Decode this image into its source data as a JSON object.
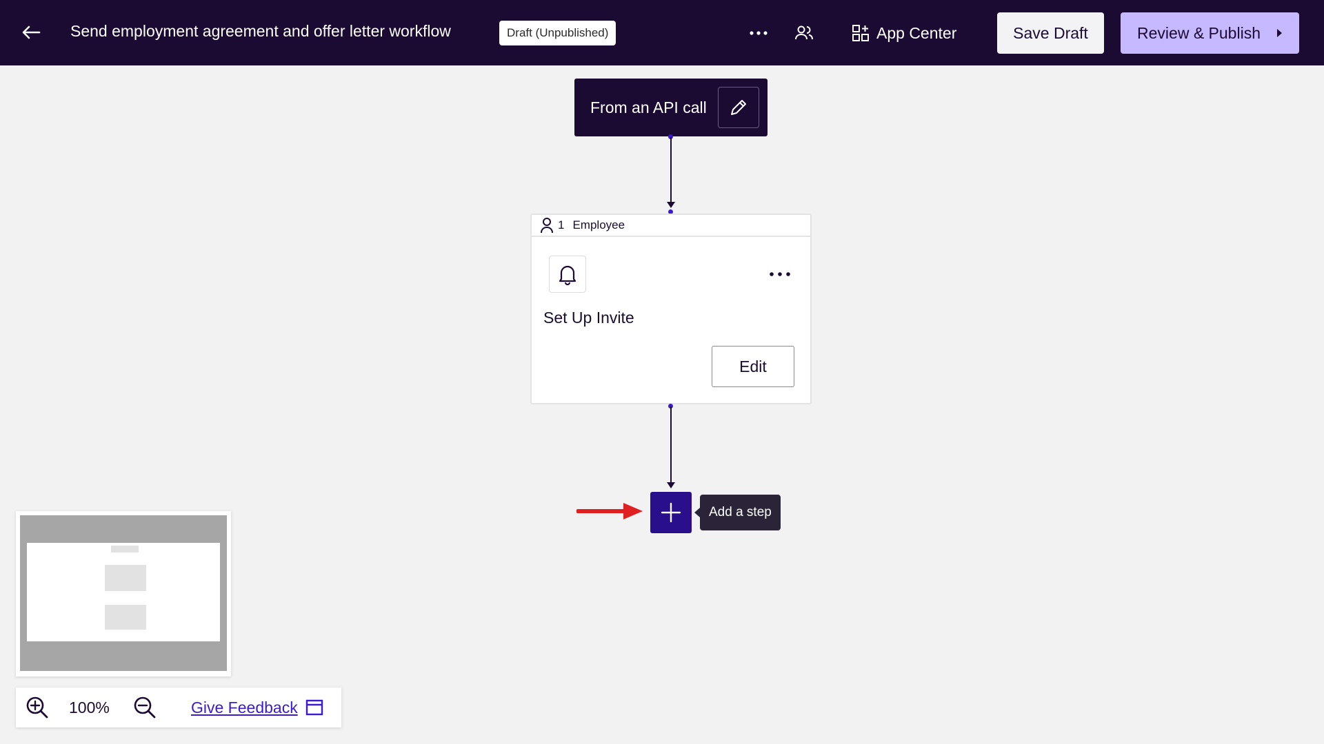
{
  "header": {
    "title": "Send employment agreement and offer letter workflow",
    "status_badge": "Draft (Unpublished)",
    "app_center_label": "App Center",
    "save_draft_label": "Save Draft",
    "review_publish_label": "Review & Publish",
    "icons": [
      "back-arrow-icon",
      "more-horizontal-icon",
      "users-icon",
      "app-grid-icon",
      "caret-right-icon"
    ]
  },
  "trigger": {
    "label": "From an API call",
    "icon": "pencil-icon"
  },
  "step": {
    "number": "1",
    "assignee": "Employee",
    "title": "Set Up Invite",
    "edit_label": "Edit",
    "icons": [
      "person-icon",
      "bell-icon",
      "more-horizontal-icon"
    ]
  },
  "add_step": {
    "tooltip": "Add a step",
    "icon": "plus-icon"
  },
  "zoom": {
    "level": "100%",
    "feedback_label": "Give Feedback",
    "icons": [
      "zoom-in-icon",
      "zoom-out-icon",
      "feedback-window-icon"
    ]
  },
  "colors": {
    "topbar_bg": "#1b0b32",
    "accent": "#c6b9ff",
    "add_step_bg": "#2a0f8c",
    "annotation_arrow": "#e02020"
  }
}
